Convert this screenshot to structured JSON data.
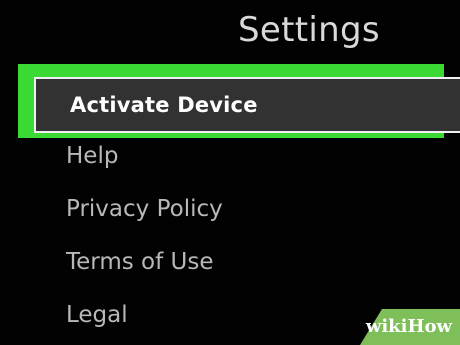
{
  "header": {
    "title": "Settings"
  },
  "menu": {
    "items": [
      {
        "label": "Activate Device",
        "selected": true
      },
      {
        "label": "Help"
      },
      {
        "label": "Privacy Policy"
      },
      {
        "label": "Terms of Use"
      },
      {
        "label": "Legal"
      }
    ]
  },
  "watermark": {
    "text": "wikiHow"
  },
  "colors": {
    "background": "#020202",
    "selection_outline": "#3ad934",
    "selection_fill": "#323232",
    "text": "#b8b8b8",
    "title_text": "#d9d9d9"
  }
}
